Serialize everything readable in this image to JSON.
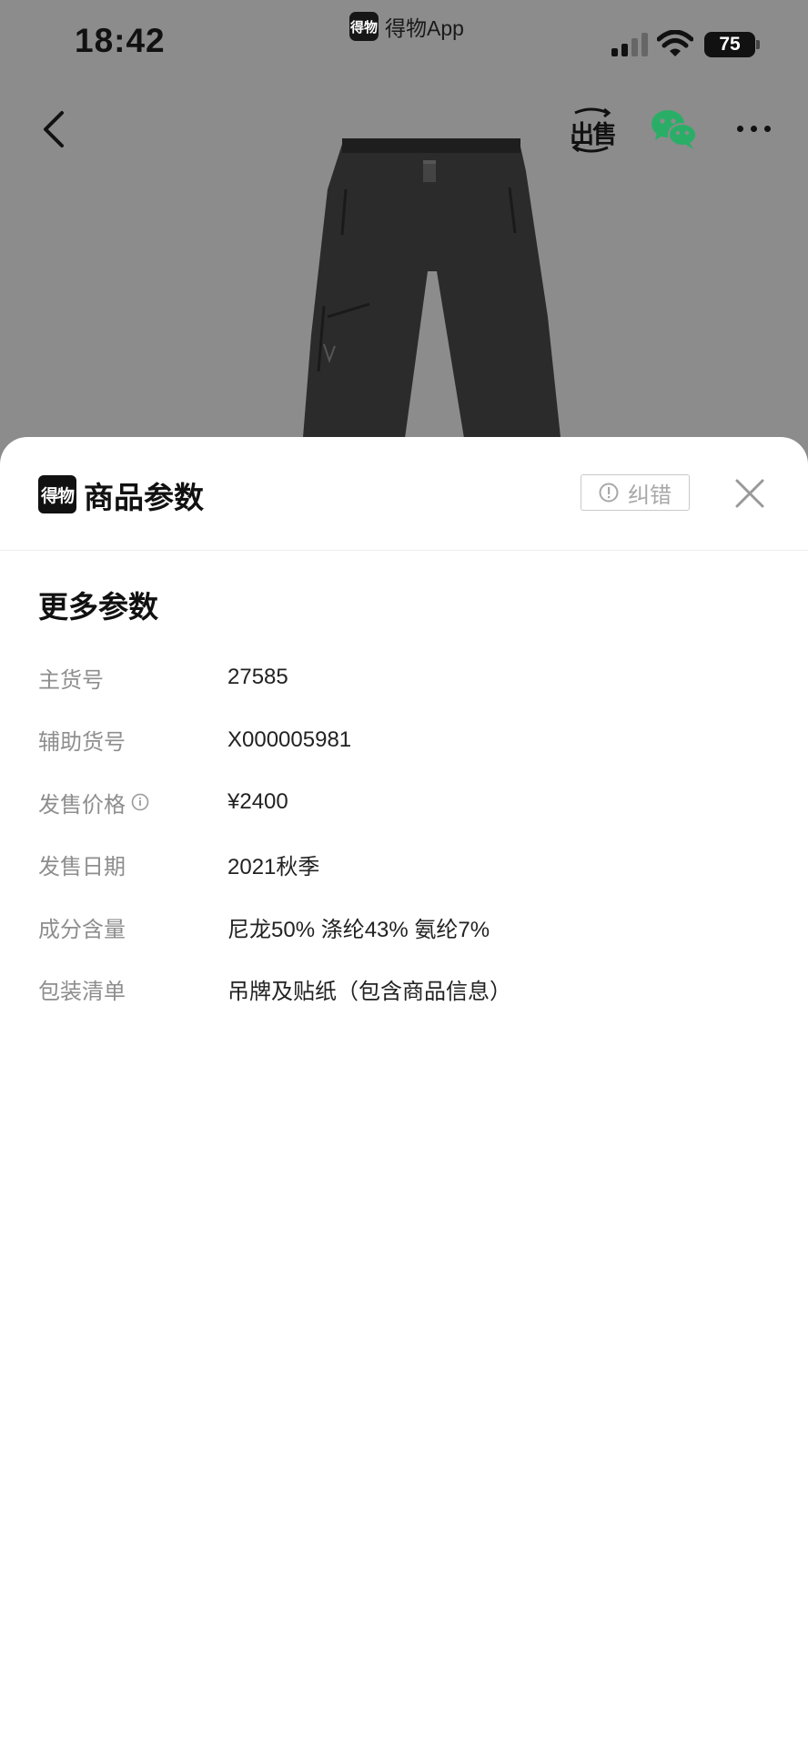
{
  "status_bar": {
    "time": "18:42",
    "app_name": "得物App",
    "app_logo_text": "得物",
    "battery_level": "75"
  },
  "nav": {
    "back_icon": "chevron-left-icon",
    "sell_label": "出售",
    "share_icon": "wechat-icon",
    "more_icon": "more-dots-icon"
  },
  "sheet": {
    "logo_text": "得物",
    "title": "商品参数",
    "correct_button_label": "纠错",
    "section_title": "更多参数",
    "params": [
      {
        "label": "主货号",
        "value": "27585",
        "has_info": false
      },
      {
        "label": "辅助货号",
        "value": "X000005981",
        "has_info": false
      },
      {
        "label": "发售价格",
        "value": "¥2400",
        "has_info": true
      },
      {
        "label": "发售日期",
        "value": "2021秋季",
        "has_info": false
      },
      {
        "label": "成分含量",
        "value": "尼龙50% 涤纶43% 氨纶7%",
        "has_info": false
      },
      {
        "label": "包装清单",
        "value": "吊牌及贴纸（包含商品信息）",
        "has_info": false
      }
    ]
  },
  "colors": {
    "backdrop": "#8c8c8c",
    "label": "#8e8e8e",
    "value": "#222222",
    "wechat_green": "#2aae67"
  }
}
